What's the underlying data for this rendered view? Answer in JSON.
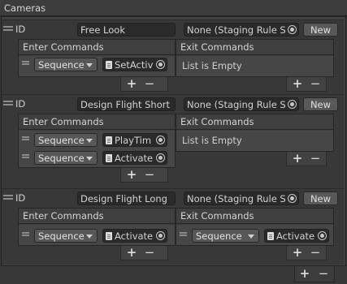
{
  "header": {
    "title": "Cameras"
  },
  "entries": [
    {
      "id_label": "ID",
      "id_value": "Free Look",
      "rule_value": "None (Staging Rule S",
      "new_label": "New",
      "enter": {
        "title": "Enter Commands",
        "rows": [
          {
            "type": "Sequence",
            "script": "SetActiv"
          }
        ]
      },
      "exit": {
        "title": "Exit Commands",
        "empty_text": "List is Empty"
      }
    },
    {
      "id_label": "ID",
      "id_value": "Design Flight Short",
      "rule_value": "None (Staging Rule S",
      "new_label": "New",
      "enter": {
        "title": "Enter Commands",
        "rows": [
          {
            "type": "Sequence",
            "script": "PlayTim"
          },
          {
            "type": "Sequence",
            "script": "Activate"
          }
        ]
      },
      "exit": {
        "title": "Exit Commands",
        "empty_text": "List is Empty"
      }
    },
    {
      "id_label": "ID",
      "id_value": "Design Flight Long",
      "rule_value": "None (Staging Rule S",
      "new_label": "New",
      "enter": {
        "title": "Enter Commands",
        "rows": [
          {
            "type": "Sequence",
            "script": "Activate"
          }
        ]
      },
      "exit": {
        "title": "Exit Commands",
        "rows": [
          {
            "type": "Sequence",
            "script": "Activate"
          }
        ]
      }
    }
  ],
  "icons": {
    "plus": "+",
    "minus": "−",
    "target": "object-picker-icon",
    "script": "script-file-icon",
    "drag": "drag-handle-icon",
    "caret": "dropdown-caret-icon"
  }
}
